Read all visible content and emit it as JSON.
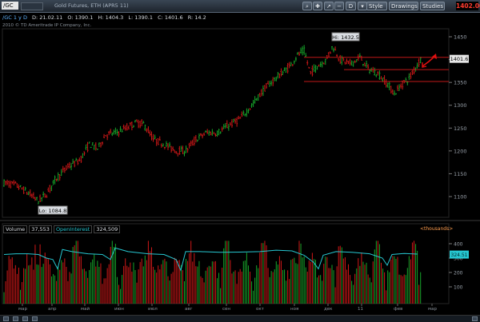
{
  "toolbar": {
    "symbol": "/GC",
    "title": "Gold Futures, ETH (APR5 11)",
    "period_label": "D",
    "buttons": {
      "style": "Style",
      "drawings": "Drawings",
      "studies": "Studies"
    },
    "last_price": "1402.00"
  },
  "info": {
    "symbol_period": "/GC 1 y D",
    "date": "D: 21.02.11",
    "open": "O: 1390.1",
    "high": "H: 1404.3",
    "low": "L: 1390.1",
    "close": "C: 1401.6",
    "range": "R: 14.2",
    "copyright": "2010 © TD Ameritrade IP Company, Inc."
  },
  "annotations": {
    "high_label": "Hi: 1432.5",
    "low_label": "Lo: 1084.8",
    "last_close_tag": "1401.6"
  },
  "price_axis": {
    "ticks": [
      "1450",
      "1400",
      "1350",
      "1300",
      "1250",
      "1200",
      "1150",
      "1100"
    ]
  },
  "volume_pane": {
    "volume_label": "Volume",
    "volume_value": "37,553",
    "oi_label": "OpenInterest",
    "oi_value": "324,509",
    "units": "<thousands>",
    "ticks": [
      "400",
      "300",
      "200",
      "100"
    ],
    "oi_tag": "324.51"
  },
  "months": [
    "мар",
    "апр",
    "май",
    "июн",
    "июл",
    "авг",
    "сен",
    "окт",
    "ноя",
    "дек",
    "11",
    "фев",
    "мар"
  ],
  "colors": {
    "up": "#17a52a",
    "down": "#d01818",
    "oi_line": "#26c6d0",
    "sr_line": "#c01818",
    "arrow": "#e01010",
    "price_tag": "#ff3b2f"
  }
}
